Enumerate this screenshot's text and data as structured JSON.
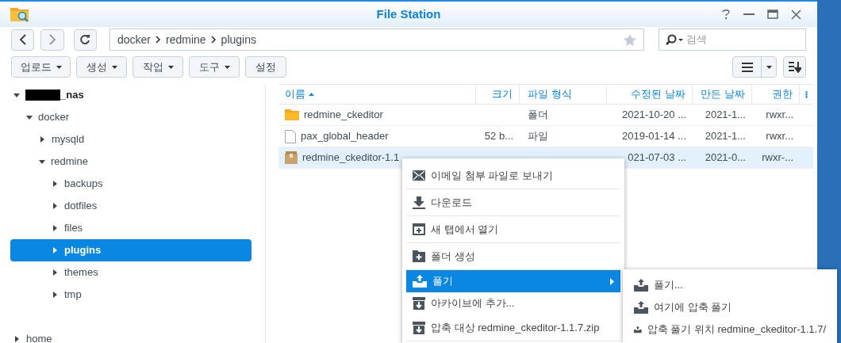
{
  "window": {
    "title": "File Station"
  },
  "path": [
    "docker",
    "redmine",
    "plugins"
  ],
  "search": {
    "placeholder": "검색"
  },
  "toolbar": [
    {
      "label": "업로드",
      "dropdown": true
    },
    {
      "label": "생성",
      "dropdown": true
    },
    {
      "label": "작업",
      "dropdown": true
    },
    {
      "label": "도구",
      "dropdown": true
    },
    {
      "label": "설정",
      "dropdown": false
    }
  ],
  "tree": [
    {
      "label": "_nas",
      "redacted": true,
      "expanded": true,
      "selected": false,
      "children": [
        {
          "label": "docker",
          "expanded": true,
          "selected": false,
          "children": [
            {
              "label": "mysqld",
              "expanded": false,
              "selected": false
            },
            {
              "label": "redmine",
              "expanded": true,
              "selected": false,
              "children": [
                {
                  "label": "backups",
                  "expanded": false,
                  "selected": false
                },
                {
                  "label": "dotfiles",
                  "expanded": false,
                  "selected": false
                },
                {
                  "label": "files",
                  "expanded": false,
                  "selected": false
                },
                {
                  "label": "plugins",
                  "expanded": false,
                  "selected": true
                },
                {
                  "label": "themes",
                  "expanded": false,
                  "selected": false
                },
                {
                  "label": "tmp",
                  "expanded": false,
                  "selected": false
                }
              ]
            }
          ]
        }
      ]
    },
    {
      "label": "home",
      "expanded": false,
      "selected": false
    }
  ],
  "table": {
    "columns": [
      {
        "label": "이름",
        "sorted": true
      },
      {
        "label": "크기",
        "sorted": false
      },
      {
        "label": "파일 형식",
        "sorted": false
      },
      {
        "label": "수정된 날짜",
        "sorted": false
      },
      {
        "label": "만든 날짜",
        "sorted": false
      },
      {
        "label": "권한",
        "sorted": false
      }
    ],
    "rows": [
      {
        "kind": "folder",
        "selected": false,
        "cells": [
          "redmine_ckeditor",
          "",
          "폴더",
          "2021-10-20 ...",
          "2021-1...",
          "rwxr..."
        ]
      },
      {
        "kind": "file",
        "selected": false,
        "cells": [
          "pax_global_header",
          "52 b...",
          "파일",
          "2019-01-14 ...",
          "2021-1...",
          "rwxr..."
        ]
      },
      {
        "kind": "archive",
        "selected": true,
        "cells": [
          "redmine_ckeditor-1.1",
          "",
          "",
          "021-07-03 ...",
          "2021-0...",
          "rwxr-..."
        ]
      }
    ]
  },
  "context_menu": {
    "items": [
      {
        "kind": "mail",
        "label": "이메일 첨부 파일로 보내기",
        "selected": false,
        "submenu": false,
        "divider_after": true
      },
      {
        "kind": "download",
        "label": "다운로드",
        "selected": false,
        "submenu": false,
        "divider_after": true
      },
      {
        "kind": "new-tab",
        "label": "새 탭에서 열기",
        "selected": false,
        "submenu": false,
        "divider_after": true
      },
      {
        "kind": "new-folder",
        "label": "폴더 생성",
        "selected": false,
        "submenu": false,
        "divider_after": true
      },
      {
        "kind": "extract",
        "label": "풀기",
        "selected": true,
        "submenu": true,
        "divider_after": false
      },
      {
        "kind": "archive",
        "label": "아카이브에 추가...",
        "selected": false,
        "submenu": false,
        "divider_after": false
      },
      {
        "kind": "archive",
        "label": "압축 대상 redmine_ckeditor-1.1.7.zip",
        "selected": false,
        "submenu": false,
        "divider_after": true
      }
    ]
  },
  "submenu": {
    "items": [
      {
        "kind": "extract",
        "label": "풀기..."
      },
      {
        "kind": "extract",
        "label": "여기에 압축 풀기"
      },
      {
        "kind": "extract",
        "label": "압축 풀기 위치 redmine_ckeditor-1.1.7/"
      }
    ]
  }
}
